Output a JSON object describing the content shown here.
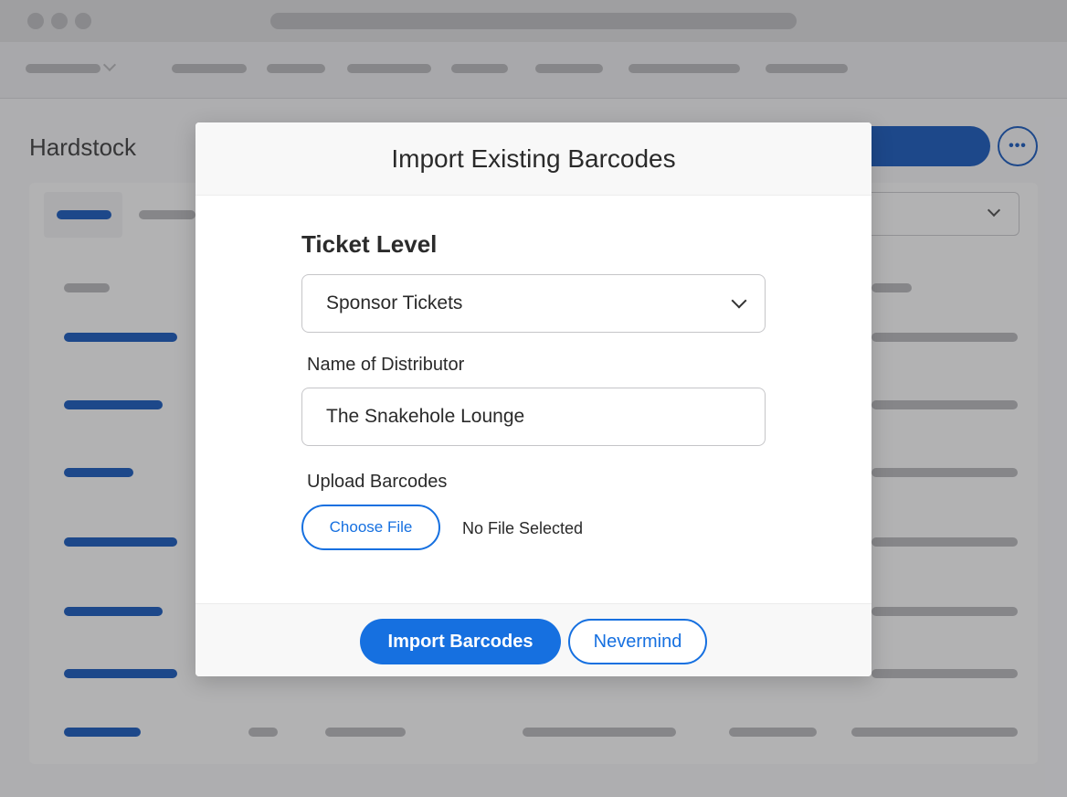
{
  "background": {
    "page_title": "Hardstock",
    "more_button_label": "•••"
  },
  "modal": {
    "title": "Import Existing Barcodes",
    "ticket_level": {
      "label": "Ticket Level",
      "selected": "Sponsor Tickets"
    },
    "distributor": {
      "label": "Name of Distributor",
      "value": "The Snakehole Lounge"
    },
    "upload": {
      "label": "Upload Barcodes",
      "choose_label": "Choose File",
      "status": "No File Selected"
    },
    "footer": {
      "import_label": "Import Barcodes",
      "cancel_label": "Nevermind"
    }
  },
  "colors": {
    "accent": "#1670e0",
    "brand_dark": "#0a4fb8"
  }
}
